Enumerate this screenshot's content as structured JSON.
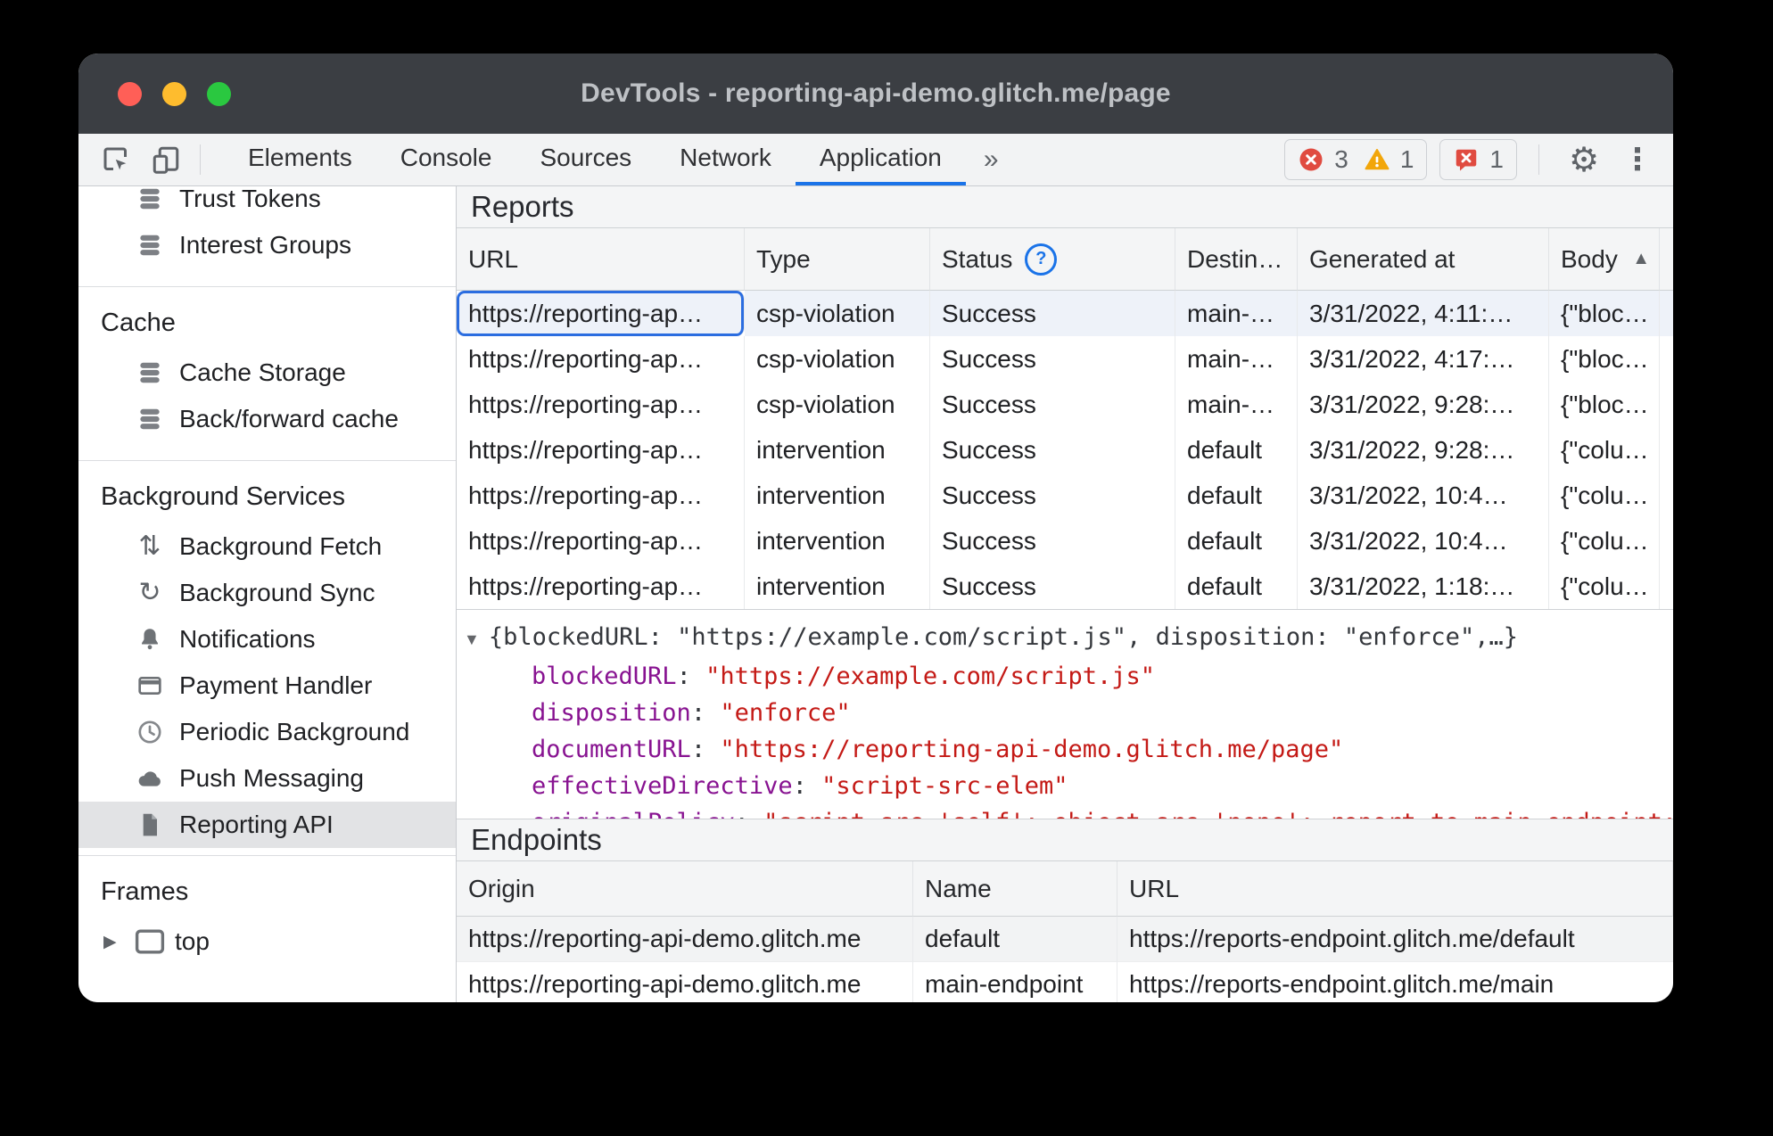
{
  "window": {
    "title": "DevTools - reporting-api-demo.glitch.me/page"
  },
  "icons": {
    "more_tabs": "»",
    "gear": "⚙",
    "kebab": "⋮",
    "help": "?",
    "sort_asc": "▲",
    "expand_triangle": "▼",
    "frame_expand": "▶",
    "fetch_arrows": "⇅",
    "sync_arrow": "↻"
  },
  "colors": {
    "accent": "#1a73e8",
    "error": "#e04b40",
    "warning": "#f2a60a",
    "titlebar": "#3b3e43",
    "selected_row": "#eef2f9"
  },
  "toolbar": {
    "tabs": [
      {
        "label": "Elements"
      },
      {
        "label": "Console"
      },
      {
        "label": "Sources"
      },
      {
        "label": "Network"
      },
      {
        "label": "Application"
      }
    ],
    "errors_count": "3",
    "warnings_count": "1",
    "issues_count": "1"
  },
  "sidebar": {
    "trust_tokens": "Trust Tokens",
    "interest_groups": "Interest Groups",
    "cache_header": "Cache",
    "cache_storage": "Cache Storage",
    "back_forward_cache": "Back/forward cache",
    "background_services_header": "Background Services",
    "background_fetch": "Background Fetch",
    "background_sync": "Background Sync",
    "notifications": "Notifications",
    "payment_handler": "Payment Handler",
    "periodic_background": "Periodic Background",
    "push_messaging": "Push Messaging",
    "reporting_api": "Reporting API",
    "frames_header": "Frames",
    "top_frame": "top"
  },
  "reports": {
    "title": "Reports",
    "columns": {
      "url": "URL",
      "type": "Type",
      "status": "Status",
      "destination": "Destin…",
      "generated": "Generated at",
      "body": "Body"
    },
    "rows": [
      {
        "url": "https://reporting-ap…",
        "type": "csp-violation",
        "status": "Success",
        "destination": "main-…",
        "generated": "3/31/2022, 4:11:…",
        "body": "{\"bloc…"
      },
      {
        "url": "https://reporting-ap…",
        "type": "csp-violation",
        "status": "Success",
        "destination": "main-…",
        "generated": "3/31/2022, 4:17:…",
        "body": "{\"bloc…"
      },
      {
        "url": "https://reporting-ap…",
        "type": "csp-violation",
        "status": "Success",
        "destination": "main-…",
        "generated": "3/31/2022, 9:28:…",
        "body": "{\"bloc…"
      },
      {
        "url": "https://reporting-ap…",
        "type": "intervention",
        "status": "Success",
        "destination": "default",
        "generated": "3/31/2022, 9:28:…",
        "body": "{\"colu…"
      },
      {
        "url": "https://reporting-ap…",
        "type": "intervention",
        "status": "Success",
        "destination": "default",
        "generated": "3/31/2022, 10:4…",
        "body": "{\"colu…"
      },
      {
        "url": "https://reporting-ap…",
        "type": "intervention",
        "status": "Success",
        "destination": "default",
        "generated": "3/31/2022, 10:4…",
        "body": "{\"colu…"
      },
      {
        "url": "https://reporting-ap…",
        "type": "intervention",
        "status": "Success",
        "destination": "default",
        "generated": "3/31/2022, 1:18:…",
        "body": "{\"colu…"
      }
    ]
  },
  "detail": {
    "summary": "{blockedURL: \"https://example.com/script.js\", disposition: \"enforce\",…}",
    "props": [
      {
        "key": "blockedURL",
        "value": "\"https://example.com/script.js\""
      },
      {
        "key": "disposition",
        "value": "\"enforce\""
      },
      {
        "key": "documentURL",
        "value": "\"https://reporting-api-demo.glitch.me/page\""
      },
      {
        "key": "effectiveDirective",
        "value": "\"script-src-elem\""
      }
    ],
    "clipped": {
      "key": "originalPolicy",
      "value": "\"script-src 'self'; object-src 'none'; report-to main-endpoint; upgrade-insecure-requests\""
    }
  },
  "endpoints": {
    "title": "Endpoints",
    "columns": {
      "origin": "Origin",
      "name": "Name",
      "url": "URL"
    },
    "rows": [
      {
        "origin": "https://reporting-api-demo.glitch.me",
        "name": "default",
        "url": "https://reports-endpoint.glitch.me/default"
      },
      {
        "origin": "https://reporting-api-demo.glitch.me",
        "name": "main-endpoint",
        "url": "https://reports-endpoint.glitch.me/main"
      }
    ]
  }
}
